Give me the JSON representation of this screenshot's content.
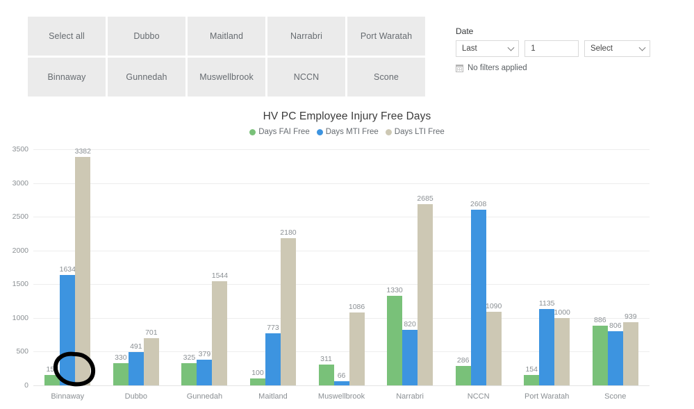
{
  "slicer": {
    "name": "site-slicer",
    "tiles": [
      {
        "label": "Select all"
      },
      {
        "label": "Dubbo"
      },
      {
        "label": "Maitland"
      },
      {
        "label": "Narrabri"
      },
      {
        "label": "Port Waratah"
      },
      {
        "label": "Binnaway"
      },
      {
        "label": "Gunnedah"
      },
      {
        "label": "Muswellbrook"
      },
      {
        "label": "NCCN"
      },
      {
        "label": "Scone"
      }
    ]
  },
  "date_filter": {
    "label": "Date",
    "relation_value": "Last",
    "amount_value": "1",
    "unit_value": "Select",
    "status_text": "No filters applied",
    "status_icon": "calendar-icon",
    "chevron_icon": "chevron-down-icon"
  },
  "chart_data": {
    "type": "bar",
    "title": "HV PC Employee Injury Free Days",
    "xlabel": "",
    "ylabel": "",
    "ylim": [
      0,
      3500
    ],
    "yticks": [
      3500,
      3000,
      2500,
      2000,
      1500,
      1000,
      500,
      0
    ],
    "grid": true,
    "legend_position": "top-center",
    "categories": [
      "Binnaway",
      "Dubbo",
      "Gunnedah",
      "Maitland",
      "Muswellbrook",
      "Narrabri",
      "NCCN",
      "Port Waratah",
      "Scone"
    ],
    "series": [
      {
        "name": "Days FAI Free",
        "color": "#79c179",
        "values": [
          157,
          330,
          325,
          100,
          311,
          1330,
          286,
          154,
          886
        ]
      },
      {
        "name": "Days MTI Free",
        "color": "#3d94e0",
        "values": [
          1634,
          491,
          379,
          773,
          66,
          820,
          2608,
          1135,
          806
        ]
      },
      {
        "name": "Days LTI Free",
        "color": "#cdc8b4",
        "values": [
          3382,
          701,
          1544,
          2180,
          1086,
          2685,
          1090,
          1000,
          939
        ]
      }
    ]
  },
  "annotation": {
    "name": "handdrawn-circle",
    "target_value": "157",
    "color": "#000000"
  }
}
